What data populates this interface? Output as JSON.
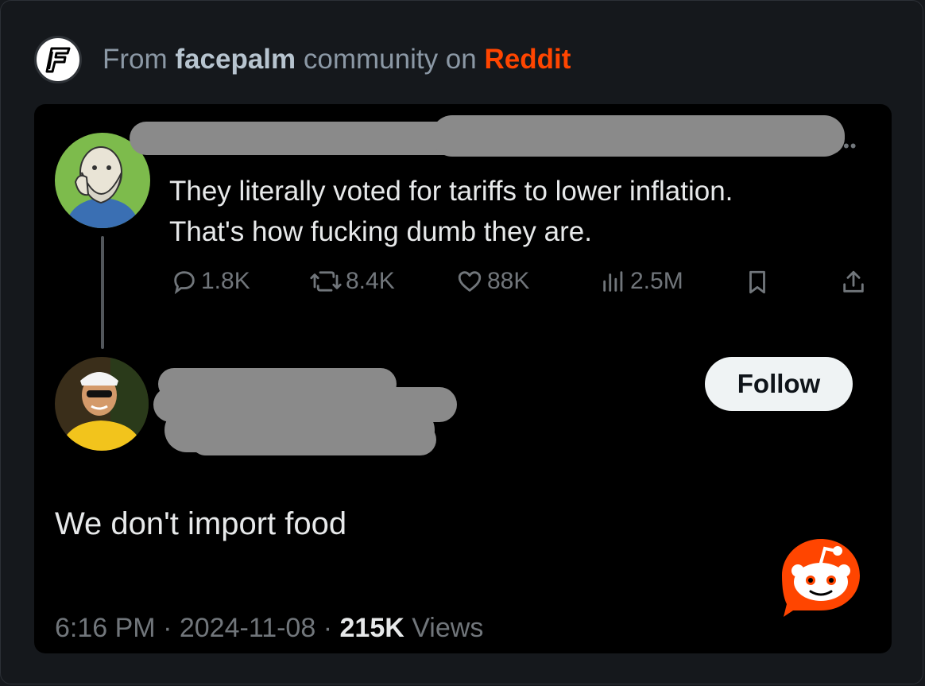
{
  "header": {
    "prefix": "From",
    "community": "facepalm",
    "middle": "community on",
    "platform": "Reddit",
    "logo_icon": "facepalm-f-logo-icon"
  },
  "original_post": {
    "text_line1": "They literally voted for tariffs to lower inflation.",
    "text_line2": "That's how fucking dumb they are.",
    "replies": "1.8K",
    "reposts": "8.4K",
    "likes": "88K",
    "views": "2.5M"
  },
  "reply_post": {
    "follow_label": "Follow",
    "text": "We don't import food",
    "time": "6:16 PM",
    "separator": "·",
    "date": "2024-11-08",
    "views_count": "215K",
    "views_label": "Views"
  },
  "colors": {
    "brand": "#ff4500",
    "background": "#000000",
    "text": "#e7e9ea",
    "muted": "#71767b"
  }
}
